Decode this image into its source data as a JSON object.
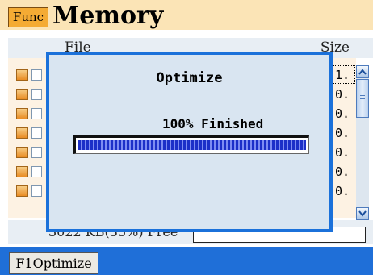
{
  "header": {
    "func_button": "Func",
    "title": "Memory"
  },
  "columns": {
    "file": "File",
    "size": "Size"
  },
  "files": [
    {
      "size": "1."
    },
    {
      "size": "0."
    },
    {
      "size": "0."
    },
    {
      "size": "0."
    },
    {
      "size": "0."
    },
    {
      "size": "0."
    },
    {
      "size": "0."
    }
  ],
  "status": {
    "free_text": "3022 KB(35%) Free",
    "free_percent": 35
  },
  "softkeys": {
    "f1": "F1Optimize"
  },
  "dialog": {
    "title": "Optimize",
    "status": "100% Finished",
    "progress": 1.0
  },
  "colors": {
    "accent_blue": "#1b71da",
    "func_orange": "#f4ab34",
    "title_bg": "#fbe4b6",
    "progress_blue": "#1c2fc8"
  },
  "icons": [
    "file-icon",
    "checkbox",
    "scroll-up-arrow-icon",
    "scroll-down-arrow-icon"
  ]
}
